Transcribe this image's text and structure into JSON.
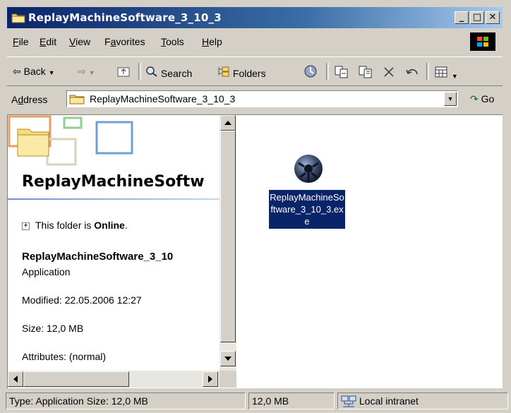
{
  "window": {
    "title": "ReplayMachineSoftware_3_10_3",
    "minimize_label": "_",
    "maximize_label": "□",
    "close_label": "✕"
  },
  "menu": {
    "items": [
      {
        "underline": "F",
        "rest": "ile"
      },
      {
        "underline": "E",
        "rest": "dit"
      },
      {
        "underline": "V",
        "rest": "iew"
      },
      {
        "pre": "F",
        "underline": "a",
        "rest": "vorites"
      },
      {
        "underline": "T",
        "rest": "ools"
      },
      {
        "underline": "H",
        "rest": "elp"
      }
    ]
  },
  "toolbar": {
    "back_label": "Back",
    "search_label": "Search",
    "folders_label": "Folders"
  },
  "address": {
    "label_underline": "d",
    "label_pre": "A",
    "label_rest": "dress",
    "value": "ReplayMachineSoftware_3_10_3",
    "go_label": "Go"
  },
  "left_pane": {
    "title": "ReplayMachineSoftw",
    "online_prefix": "This folder is ",
    "online_status": "Online",
    "online_suffix": ".",
    "selected_name": "ReplayMachineSoftware_3_10",
    "selected_type": "Application",
    "modified": "Modified: 22.05.2006 12:27",
    "size": "Size: 12,0 MB",
    "attributes": "Attributes: (normal)"
  },
  "file": {
    "name": "ReplayMachineSoftware_3_10_3.exe",
    "icon": "application-sphere-icon"
  },
  "status": {
    "type_size": "Type: Application Size: 12,0 MB",
    "size": "12,0 MB",
    "zone": "Local intranet"
  },
  "colors": {
    "titlebar_start": "#0a246a",
    "titlebar_end": "#a6caf0",
    "selection": "#0a246a",
    "chrome": "#d4d0c8"
  }
}
